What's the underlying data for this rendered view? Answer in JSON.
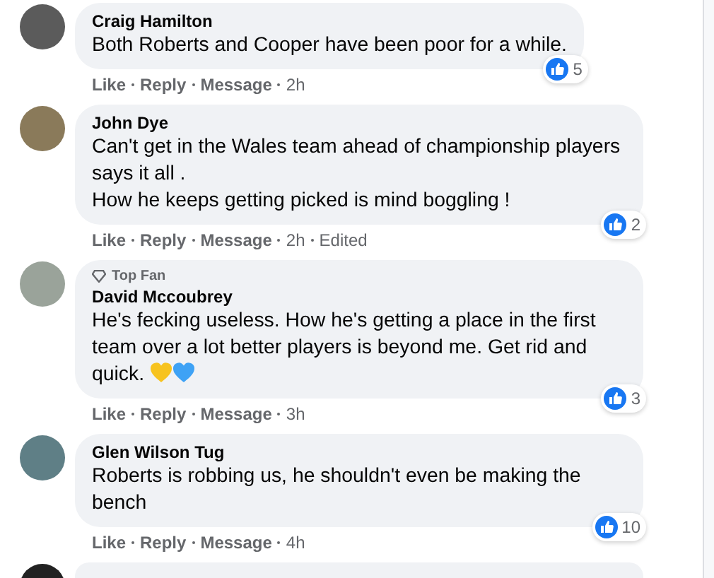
{
  "comments": [
    {
      "author": "Craig Hamilton",
      "text": "Both Roberts and Cooper have been poor for a while.",
      "actions": [
        "Like",
        "Reply",
        "Message",
        "2h"
      ],
      "reactions": "5"
    },
    {
      "author": "John Dye",
      "text": "Can't get in the Wales team ahead of championship players says it all .\nHow he keeps getting picked is mind boggling !",
      "actions": [
        "Like",
        "Reply",
        "Message",
        "2h",
        "Edited"
      ],
      "reactions": "2"
    },
    {
      "badge": "Top Fan",
      "author": "David Mccoubrey",
      "text": "He's fecking useless. How he's getting a place in the first team over a lot better players is beyond me. Get rid and quick.",
      "hearts": [
        {
          "color": "#f7c31f"
        },
        {
          "color": "#3ea2f5"
        }
      ],
      "actions": [
        "Like",
        "Reply",
        "Message",
        "3h"
      ],
      "reactions": "3"
    },
    {
      "author": "Glen Wilson Tug",
      "text": "Roberts is robbing us, he shouldn't even be making the bench",
      "actions": [
        "Like",
        "Reply",
        "Message",
        "4h"
      ],
      "reactions": "10"
    }
  ]
}
